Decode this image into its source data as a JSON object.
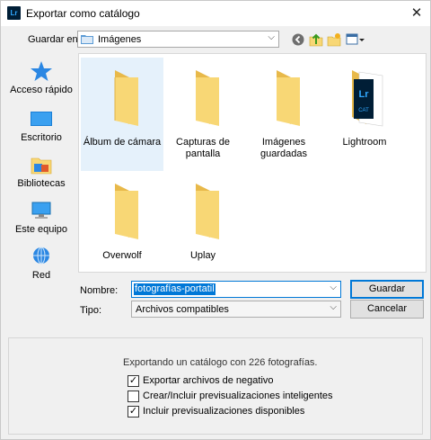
{
  "window": {
    "title": "Exportar como catálogo",
    "app_icon_text": "Lr"
  },
  "savein": {
    "label": "Guardar en:",
    "value": "Imágenes"
  },
  "places": [
    {
      "label": "Acceso rápido",
      "icon": "star-icon"
    },
    {
      "label": "Escritorio",
      "icon": "desktop-icon"
    },
    {
      "label": "Bibliotecas",
      "icon": "libraries-icon"
    },
    {
      "label": "Este equipo",
      "icon": "computer-icon"
    },
    {
      "label": "Red",
      "icon": "network-icon"
    }
  ],
  "files": [
    {
      "name": "Álbum de cámara",
      "selected": true
    },
    {
      "name": "Capturas de pantalla",
      "selected": false
    },
    {
      "name": "Imágenes guardadas",
      "selected": false
    },
    {
      "name": "Lightroom",
      "selected": false,
      "badge_top": "Lr",
      "badge_bottom": "CAT"
    },
    {
      "name": "Overwolf",
      "selected": false
    },
    {
      "name": "Uplay",
      "selected": false
    }
  ],
  "form": {
    "name_label": "Nombre:",
    "name_value": "fotografías-portatil",
    "type_label": "Tipo:",
    "type_value": "Archivos compatibles",
    "save_button": "Guardar",
    "cancel_button": "Cancelar"
  },
  "options": {
    "info": "Exportando un catálogo con 226 fotografías.",
    "checkboxes": [
      {
        "label": "Exportar archivos de negativo",
        "checked": true
      },
      {
        "label": "Crear/Incluir previsualizaciones inteligentes",
        "checked": false
      },
      {
        "label": "Incluir previsualizaciones disponibles",
        "checked": true
      }
    ]
  },
  "colors": {
    "selection": "#0078d7",
    "folder": "#f8d775",
    "lr_badge": "#001e36"
  }
}
